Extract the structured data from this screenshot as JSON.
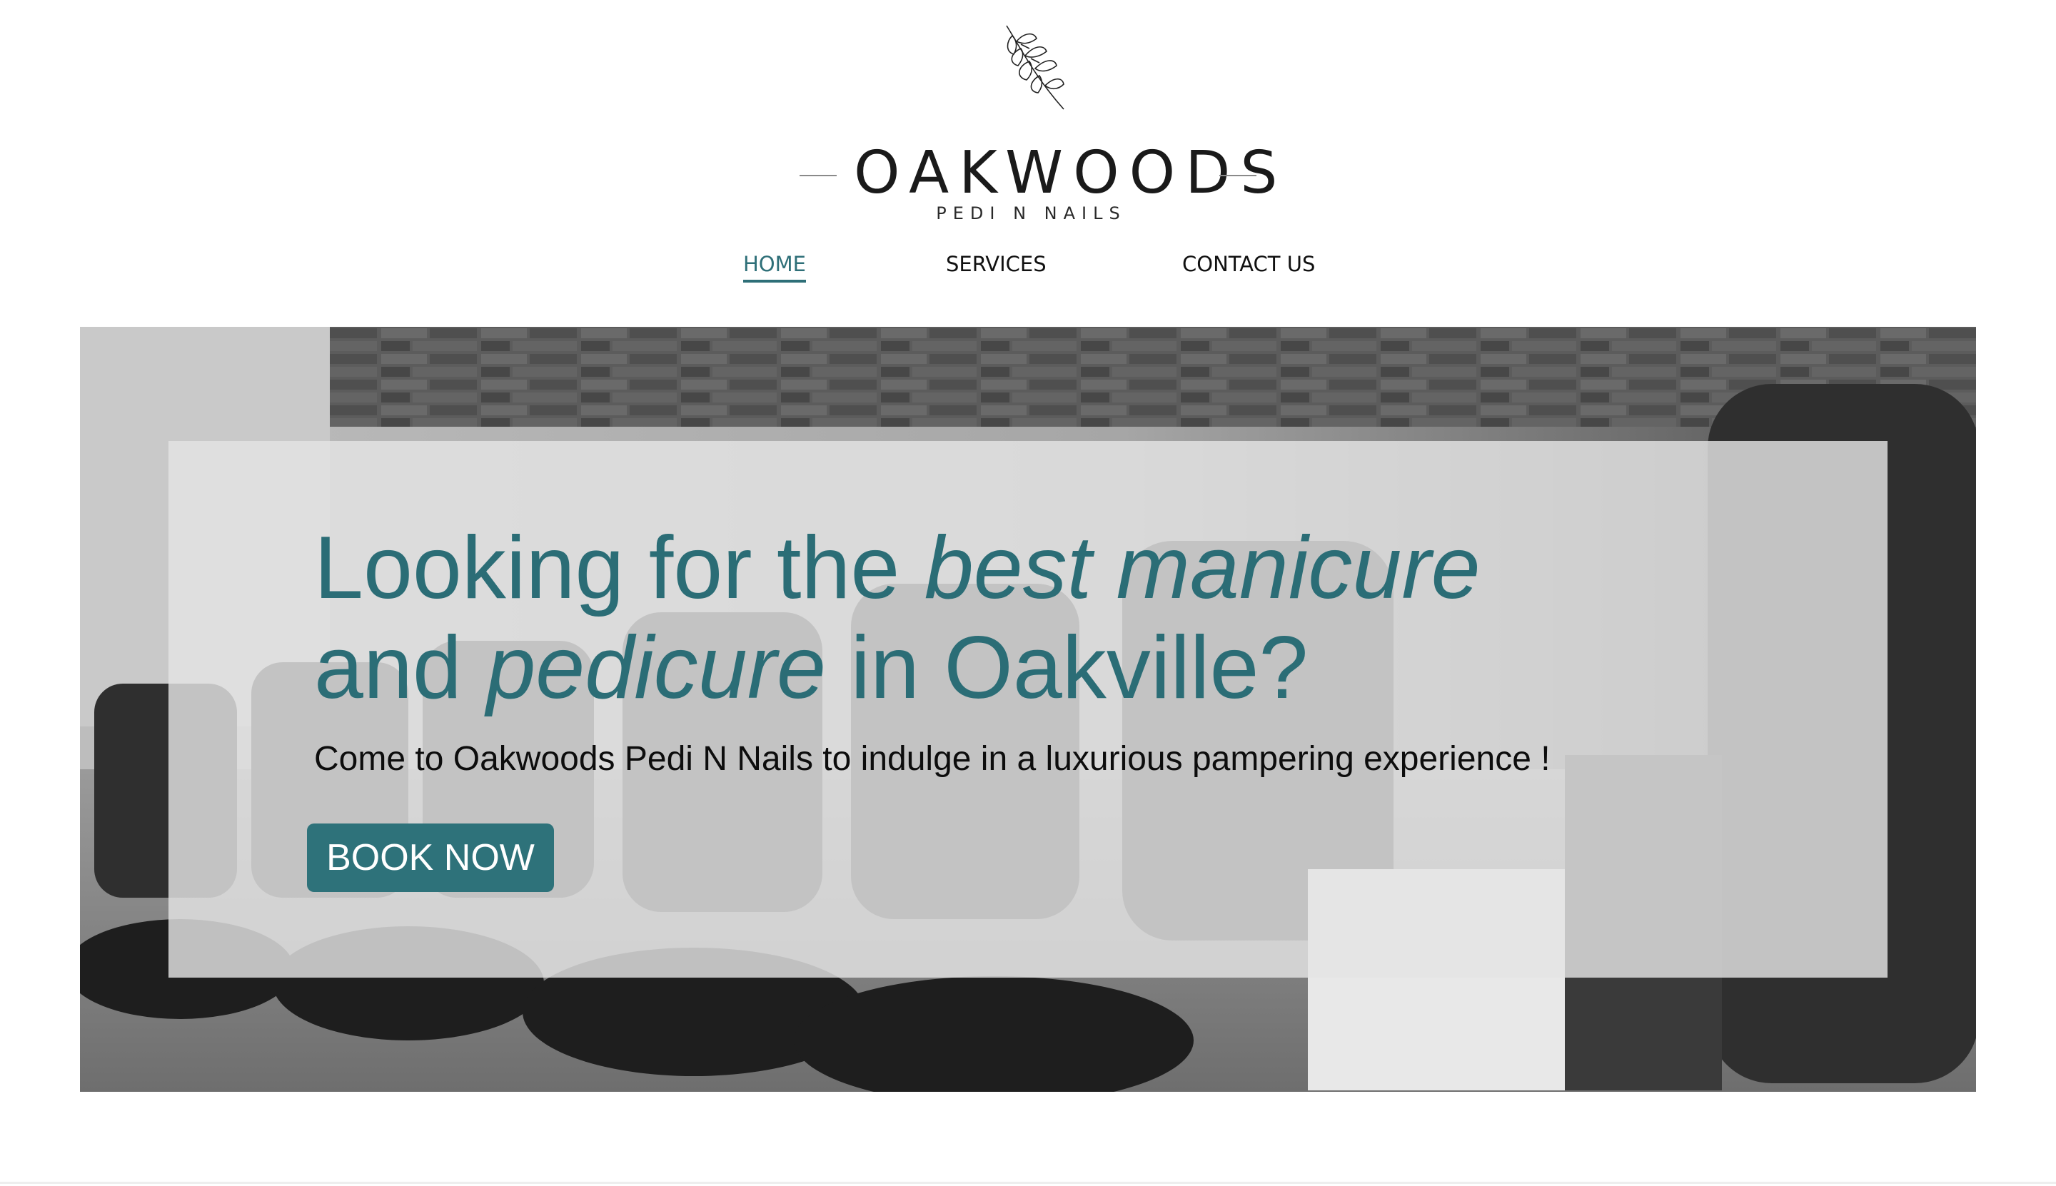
{
  "brand": {
    "name": "OAKWOODS",
    "tagline": "PEDI N NAILS",
    "logo_icon": "leaf-sprig-icon"
  },
  "nav": {
    "items": [
      {
        "label": "HOME",
        "active": true
      },
      {
        "label": "SERVICES",
        "active": false
      },
      {
        "label": "CONTACT US",
        "active": false
      }
    ]
  },
  "hero": {
    "heading_part1": "Looking for the ",
    "heading_em1": "best manicure",
    "heading_part2": "and ",
    "heading_em2": "pedicure",
    "heading_part3": " in Oakville?",
    "subheading": "Come to Oakwoods Pedi N Nails to indulge in a luxurious pampering experience !",
    "cta_label": "BOOK NOW",
    "background": "pedicure-chairs-photo"
  },
  "colors": {
    "accent": "#2e727a",
    "heading": "#2b6d76",
    "text": "#0d0d0d",
    "background": "#ffffff"
  }
}
